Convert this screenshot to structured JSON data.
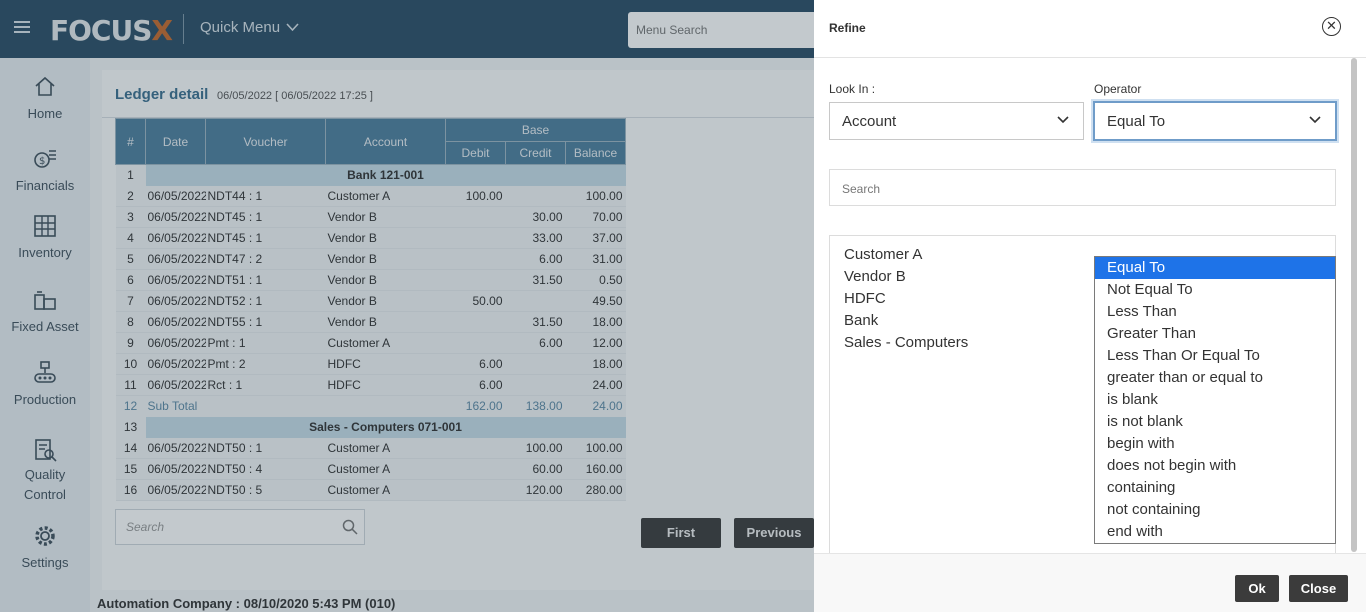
{
  "header": {
    "logo_text": "FOCUS",
    "logo_mark": "X",
    "quick_menu": "Quick Menu",
    "menu_search_placeholder": "Menu Search"
  },
  "sidebar": {
    "items": [
      {
        "label": "Home",
        "icon": "home-icon"
      },
      {
        "label": "Financials",
        "icon": "financials-icon"
      },
      {
        "label": "Inventory",
        "icon": "inventory-icon"
      },
      {
        "label": "Fixed Asset",
        "icon": "fixed-asset-icon"
      },
      {
        "label": "Production",
        "icon": "production-icon"
      },
      {
        "label": "Quality Control",
        "icon": "quality-control-icon"
      },
      {
        "label": "Settings",
        "icon": "gear-icon"
      }
    ]
  },
  "report": {
    "title": "Ledger detail",
    "date_range": "06/05/2022 [ 06/05/2022 17:25 ]",
    "columns": {
      "num": "#",
      "date": "Date",
      "voucher": "Voucher",
      "account": "Account",
      "base": "Base",
      "debit": "Debit",
      "credit": "Credit",
      "balance": "Balance"
    },
    "rows": [
      {
        "n": "1",
        "group": "Bank 121-001"
      },
      {
        "n": "2",
        "date": "06/05/2022",
        "voucher": "NDT44 : 1",
        "account": "Customer A",
        "debit": "100.00",
        "credit": "",
        "balance": "100.00"
      },
      {
        "n": "3",
        "date": "06/05/2022",
        "voucher": "NDT45 : 1",
        "account": "Vendor B",
        "debit": "",
        "credit": "30.00",
        "balance": "70.00"
      },
      {
        "n": "4",
        "date": "06/05/2022",
        "voucher": "NDT45 : 1",
        "account": "Vendor B",
        "debit": "",
        "credit": "33.00",
        "balance": "37.00"
      },
      {
        "n": "5",
        "date": "06/05/2022",
        "voucher": "NDT47 : 2",
        "account": "Vendor B",
        "debit": "",
        "credit": "6.00",
        "balance": "31.00"
      },
      {
        "n": "6",
        "date": "06/05/2022",
        "voucher": "NDT51 : 1",
        "account": "Vendor B",
        "debit": "",
        "credit": "31.50",
        "balance": "0.50"
      },
      {
        "n": "7",
        "date": "06/05/2022",
        "voucher": "NDT52 : 1",
        "account": "Vendor B",
        "debit": "50.00",
        "credit": "",
        "balance": "49.50"
      },
      {
        "n": "8",
        "date": "06/05/2022",
        "voucher": "NDT55 : 1",
        "account": "Vendor B",
        "debit": "",
        "credit": "31.50",
        "balance": "18.00"
      },
      {
        "n": "9",
        "date": "06/05/2022",
        "voucher": "Pmt : 1",
        "account": "Customer A",
        "debit": "",
        "credit": "6.00",
        "balance": "12.00"
      },
      {
        "n": "10",
        "date": "06/05/2022",
        "voucher": "Pmt : 2",
        "account": "HDFC",
        "debit": "6.00",
        "credit": "",
        "balance": "18.00"
      },
      {
        "n": "11",
        "date": "06/05/2022",
        "voucher": "Rct : 1",
        "account": "HDFC",
        "debit": "6.00",
        "credit": "",
        "balance": "24.00"
      },
      {
        "n": "12",
        "subtotal": "Sub Total",
        "debit": "162.00",
        "credit": "138.00",
        "balance": "24.00"
      },
      {
        "n": "13",
        "group": "Sales - Computers 071-001"
      },
      {
        "n": "14",
        "date": "06/05/2022",
        "voucher": "NDT50 : 1",
        "account": "Customer A",
        "debit": "",
        "credit": "100.00",
        "balance": "100.00"
      },
      {
        "n": "15",
        "date": "06/05/2022",
        "voucher": "NDT50 : 4",
        "account": "Customer A",
        "debit": "",
        "credit": "60.00",
        "balance": "160.00"
      },
      {
        "n": "16",
        "date": "06/05/2022",
        "voucher": "NDT50 : 5",
        "account": "Customer A",
        "debit": "",
        "credit": "120.00",
        "balance": "280.00"
      }
    ],
    "search_placeholder": "Search",
    "btn_first": "First",
    "btn_previous": "Previous"
  },
  "footer": {
    "status": "Automation Company : 08/10/2020 5:43 PM (010)"
  },
  "refine": {
    "title": "Refine",
    "look_in_label": "Look In :",
    "look_in_value": "Account",
    "operator_label": "Operator",
    "operator_value": "Equal To",
    "search_placeholder": "Search",
    "values": [
      "Customer A",
      "Vendor B",
      "HDFC",
      "Bank",
      "Sales - Computers"
    ],
    "operator_options": [
      "Equal To",
      "Not Equal To",
      "Less Than",
      "Greater Than",
      "Less Than Or Equal To",
      "greater than or equal to",
      "is blank",
      "is not blank",
      "begin with",
      "does not begin with",
      "containing",
      "not containing",
      "end with"
    ],
    "selected_option_index": 0,
    "ok_label": "Ok",
    "close_label": "Close"
  },
  "colors": {
    "header_bg": "#2a4d66",
    "table_header_bg": "#4d7e9d",
    "group_row_bg": "#c6dde8",
    "selected_option_bg": "#1e73e8",
    "button_dark": "#3b3b3b"
  }
}
